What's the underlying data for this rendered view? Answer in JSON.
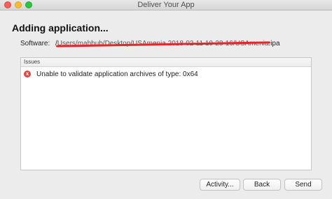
{
  "window": {
    "title": "Deliver Your App"
  },
  "heading": "Adding application...",
  "software": {
    "label": "Software:",
    "path_prefix": "/",
    "path_redacted": "Users/mahbub/Desktop/USAmenia 2018-02-11 10-28-16/USAmenia",
    "path_suffix": ".ipa"
  },
  "issues": {
    "header": "Issues",
    "items": [
      {
        "icon": "error-icon",
        "glyph": "x",
        "text": "Unable to validate application archives of type: 0x64"
      }
    ]
  },
  "buttons": {
    "activity": "Activity...",
    "back": "Back",
    "send": "Send"
  },
  "colors": {
    "error": "#e0443e",
    "redaction": "#e8262a"
  }
}
